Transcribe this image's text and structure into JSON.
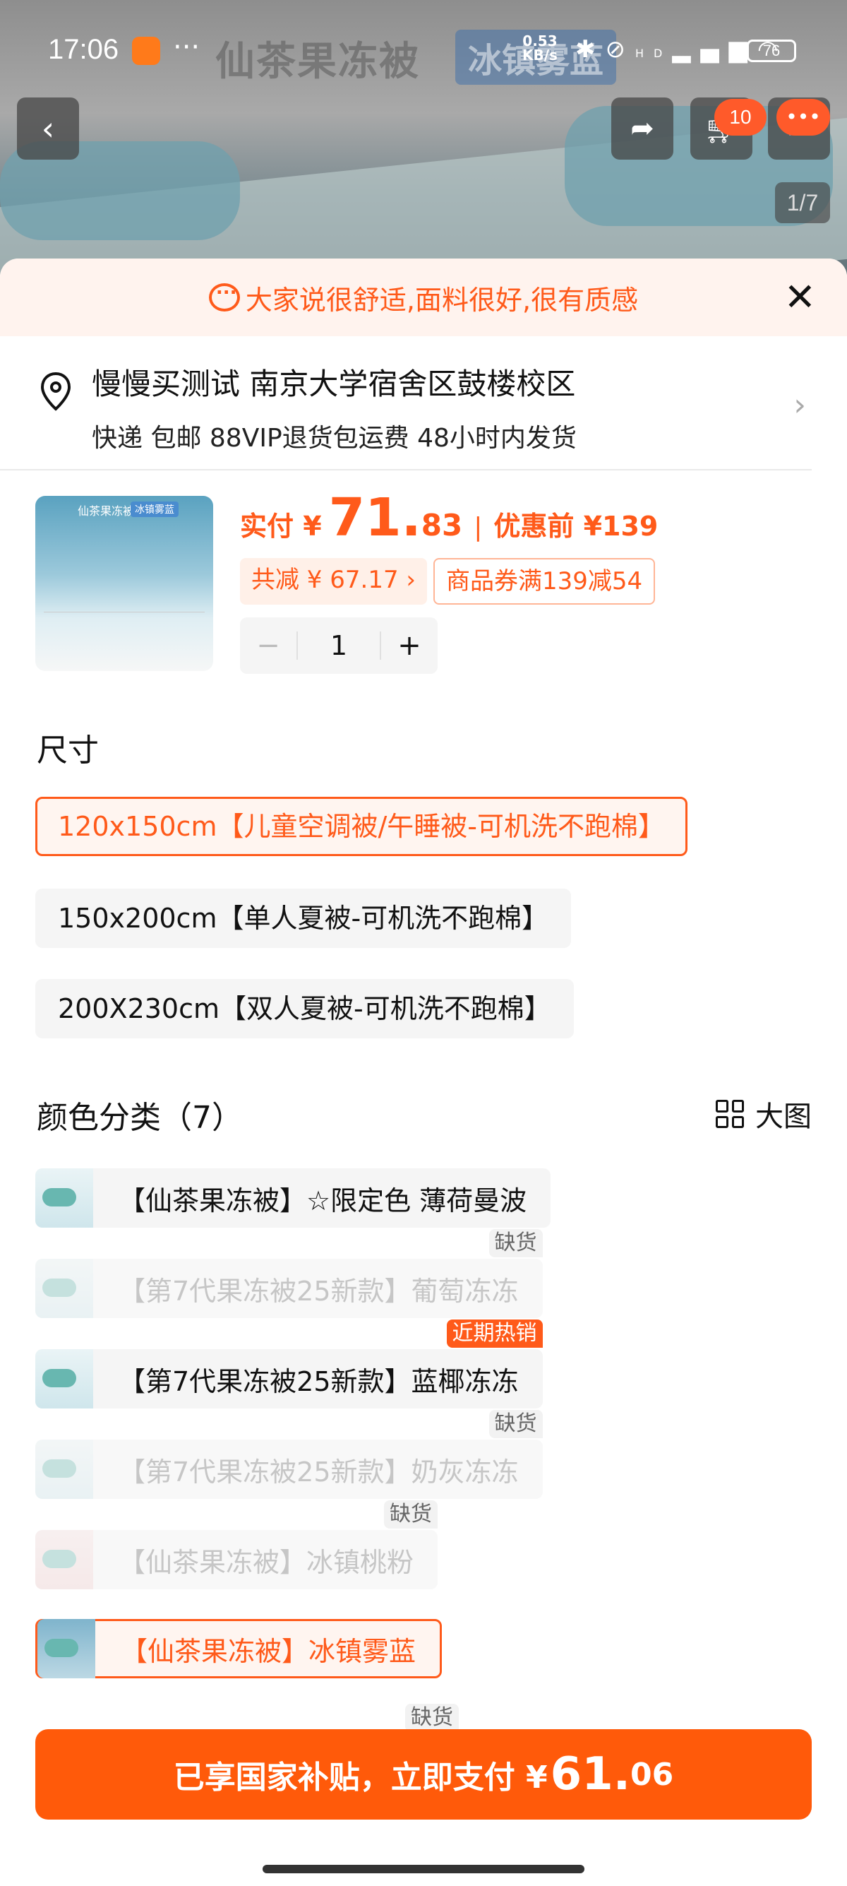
{
  "status_bar": {
    "time": "17:06",
    "more": "···",
    "speed_value": "0.53",
    "speed_unit": "KB/s",
    "signal_label": "HD",
    "battery": "76"
  },
  "hero": {
    "title_ghost": "仙茶果冻被",
    "tag_ghost": "冰镇雾蓝",
    "cart_count": "10",
    "pager": "1/7"
  },
  "banner": {
    "text": "大家说很舒适,面料很好,很有质感",
    "close": "✕"
  },
  "address": {
    "line1": "慢慢买测试 南京大学宿舍区鼓楼校区",
    "line2": "快递 包邮 88VIP退货包运费 48小时内发货"
  },
  "product": {
    "thumb_title": "仙茶果冻被",
    "thumb_tag": "冰镇雾蓝",
    "price_label": "实付 ¥",
    "price_int": "71.",
    "price_dec": "83",
    "separator": "|",
    "original": "优惠前 ¥139",
    "save_chip": "共减 ¥ 67.17 ›",
    "coupon_chip": "商品券满139减54",
    "qty_minus": "−",
    "qty": "1",
    "qty_plus": "+"
  },
  "size_section": {
    "title": "尺寸",
    "options": [
      "120x150cm【儿童空调被/午睡被-可机洗不跑棉】",
      "150x200cm【单人夏被-可机洗不跑棉】",
      "200X230cm【双人夏被-可机洗不跑棉】"
    ],
    "selected_index": 0
  },
  "color_section": {
    "title": "颜色分类（7）",
    "big_view": "大图",
    "items": [
      {
        "label": "【仙茶果冻被】☆限定色 薄荷曼波",
        "badge": ""
      },
      {
        "label": "【第7代果冻被25新款】葡萄冻冻",
        "badge": "缺货"
      },
      {
        "label": "【第7代果冻被25新款】蓝椰冻冻",
        "badge": "近期热销"
      },
      {
        "label": "【第7代果冻被25新款】奶灰冻冻",
        "badge": "缺货"
      },
      {
        "label": "【仙茶果冻被】冰镇桃粉",
        "badge": "缺货"
      },
      {
        "label": "【仙茶果冻被】冰镇雾蓝",
        "badge": ""
      },
      {
        "label": "",
        "badge": "缺货"
      }
    ]
  },
  "pay_button": {
    "label": "已享国家补贴，立即支付 ¥",
    "amount_int": "61.",
    "amount_dec": "06"
  },
  "colors": {
    "accent": "#ff5a1a",
    "pay_bg": "#ff5a0a",
    "banner_bg": "#fff3ee"
  }
}
